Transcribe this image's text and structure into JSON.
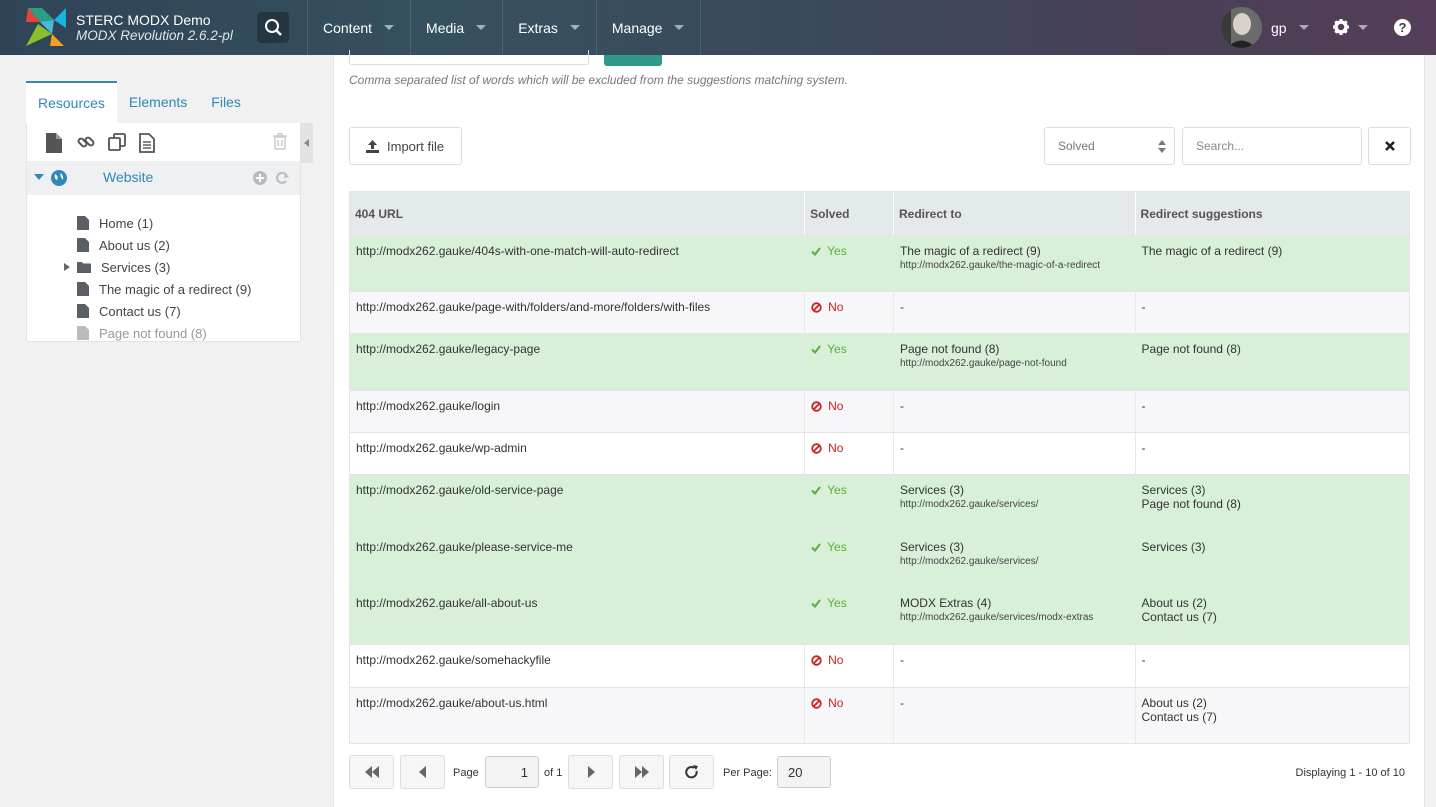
{
  "header": {
    "site_name": "STERC MODX Demo",
    "version": "MODX Revolution 2.6.2-pl",
    "nav": [
      "Content",
      "Media",
      "Extras",
      "Manage"
    ],
    "user": "gp",
    "help": "?"
  },
  "tree": {
    "tabs": [
      "Resources",
      "Elements",
      "Files"
    ],
    "context": "Website",
    "items": [
      {
        "label": "Home (1)",
        "type": "file"
      },
      {
        "label": "About us (2)",
        "type": "file"
      },
      {
        "label": "Services (3)",
        "type": "folder"
      },
      {
        "label": "The magic of a redirect (9)",
        "type": "file"
      },
      {
        "label": "Contact us (7)",
        "type": "file"
      },
      {
        "label": "Page not found (8)",
        "type": "file-dim"
      }
    ]
  },
  "main": {
    "hint": "Comma separated list of words which will be excluded from the suggestions matching system.",
    "import_label": "Import file",
    "solved_filter": "Solved",
    "search_placeholder": "Search...",
    "columns": [
      "404 URL",
      "Solved",
      "Redirect to",
      "Redirect suggestions"
    ],
    "rows": [
      {
        "url": "http://modx262.gauke/404s-with-one-match-will-auto-redirect",
        "solved": "Yes",
        "redirect": "The magic of a redirect (9)",
        "redirect_url": "http://modx262.gauke/the-magic-of-a-redirect",
        "suggestions": [
          "The magic of a redirect (9)"
        ]
      },
      {
        "url": "http://modx262.gauke/page-with/folders/and-more/folders/with-files",
        "solved": "No",
        "redirect": "-",
        "redirect_url": "",
        "suggestions": [
          "-"
        ]
      },
      {
        "url": "http://modx262.gauke/legacy-page",
        "solved": "Yes",
        "redirect": "Page not found (8)",
        "redirect_url": "http://modx262.gauke/page-not-found",
        "suggestions": [
          "Page not found (8)"
        ]
      },
      {
        "url": "http://modx262.gauke/login",
        "solved": "No",
        "redirect": "-",
        "redirect_url": "",
        "suggestions": [
          "-"
        ]
      },
      {
        "url": "http://modx262.gauke/wp-admin",
        "solved": "No",
        "redirect": "-",
        "redirect_url": "",
        "suggestions": [
          "-"
        ]
      },
      {
        "url": "http://modx262.gauke/old-service-page",
        "solved": "Yes",
        "redirect": "Services (3)",
        "redirect_url": "http://modx262.gauke/services/",
        "suggestions": [
          "Services (3)",
          "Page not found (8)"
        ]
      },
      {
        "url": "http://modx262.gauke/please-service-me",
        "solved": "Yes",
        "redirect": "Services (3)",
        "redirect_url": "http://modx262.gauke/services/",
        "suggestions": [
          "Services (3)"
        ]
      },
      {
        "url": "http://modx262.gauke/all-about-us",
        "solved": "Yes",
        "redirect": "MODX Extras (4)",
        "redirect_url": "http://modx262.gauke/services/modx-extras",
        "suggestions": [
          "About us (2)",
          "Contact us (7)"
        ]
      },
      {
        "url": "http://modx262.gauke/somehackyfile",
        "solved": "No",
        "redirect": "-",
        "redirect_url": "",
        "suggestions": [
          "-"
        ]
      },
      {
        "url": "http://modx262.gauke/about-us.html",
        "solved": "No",
        "redirect": "-",
        "redirect_url": "",
        "suggestions": [
          "About us (2)",
          "Contact us (7)"
        ]
      }
    ]
  },
  "pager": {
    "page_label": "Page",
    "page": "1",
    "of_label": "of 1",
    "per_page_label": "Per Page:",
    "per_page": "20",
    "display": "Displaying 1 - 10 of 10"
  },
  "colors": {
    "accent": "#2e88b8",
    "solved_bg": "#d8efd8",
    "yes": "#5cae3a",
    "no": "#cc2222"
  }
}
